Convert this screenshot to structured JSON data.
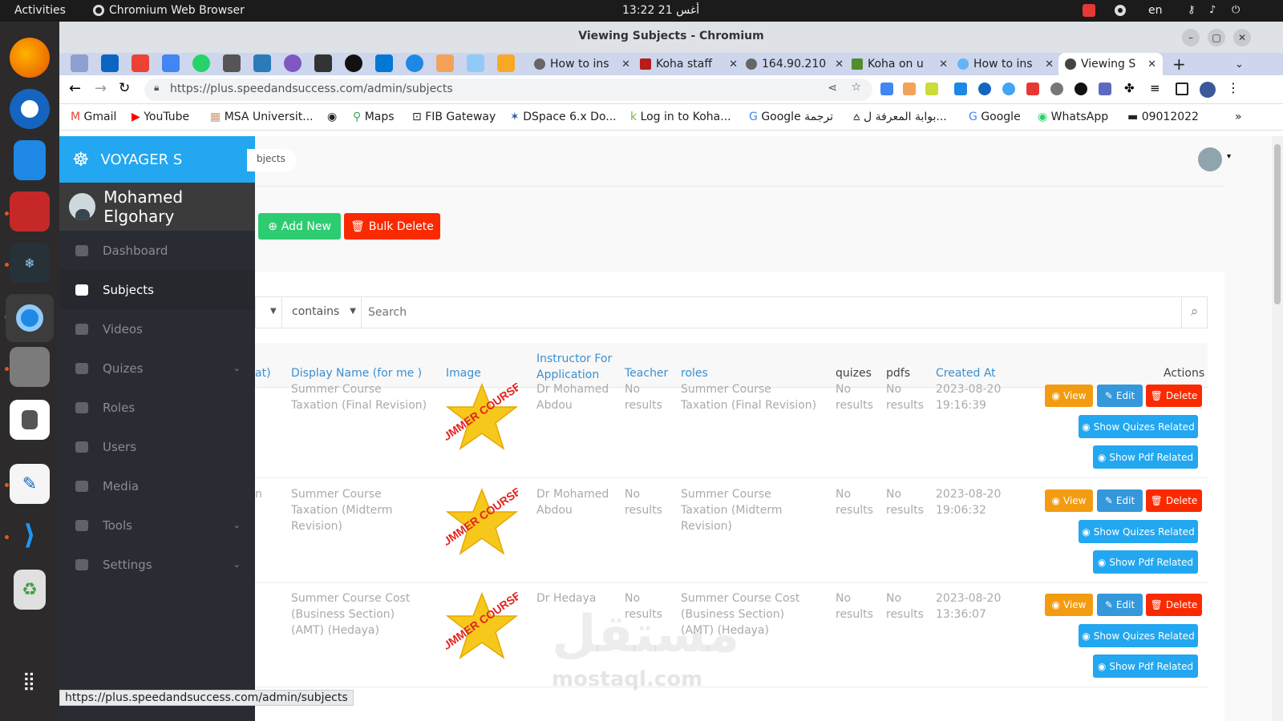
{
  "topbar": {
    "activities": "Activities",
    "app": "Chromium Web Browser",
    "clock": "13:22  21 أغس",
    "lang": "en"
  },
  "window": {
    "title": "Viewing Subjects - Chromium"
  },
  "tabs": [
    {
      "label": "How to ins"
    },
    {
      "label": "Koha staff"
    },
    {
      "label": "164.90.210"
    },
    {
      "label": "Koha on u"
    },
    {
      "label": "How to ins"
    },
    {
      "label": "Viewing S"
    }
  ],
  "address": {
    "url": "https://plus.speedandsuccess.com/admin/subjects"
  },
  "bookmarks": [
    "Gmail",
    "YouTube",
    "MSA Universit...",
    "Maps",
    "FIB Gateway",
    "DSpace 6.x Do...",
    "Log in to Koha...",
    "Google ترجمة",
    "بوابة المعرفة ل...",
    "Google",
    "WhatsApp",
    "09012022"
  ],
  "sidebar": {
    "brand": "VOYAGER S",
    "user": "Mohamed Elgohary",
    "items": [
      {
        "label": "Dashboard"
      },
      {
        "label": "Subjects"
      },
      {
        "label": "Videos"
      },
      {
        "label": "Quizes"
      },
      {
        "label": "Roles"
      },
      {
        "label": "Users"
      },
      {
        "label": "Media"
      },
      {
        "label": "Tools"
      },
      {
        "label": "Settings"
      }
    ]
  },
  "main": {
    "breadcrumb": "bjects",
    "add_new": "Add New",
    "bulk_delete": "Bulk Delete",
    "filter_op": "contains",
    "search_placeholder": "Search",
    "columns": {
      "name": "at)",
      "display": "Display Name (for me )",
      "image": "Image",
      "instructor": "Instructor For Application",
      "teacher": "Teacher",
      "roles": "roles",
      "quizes": "quizes",
      "pdfs": "pdfs",
      "created": "Created At",
      "actions": "Actions"
    },
    "btn_view": "View",
    "btn_edit": "Edit",
    "btn_delete": "Delete",
    "btn_quizes": "Show Quizes Related",
    "btn_pdf": "Show Pdf Related",
    "rows": [
      {
        "name": "",
        "display": "Summer Course Taxation (Final Revision)",
        "image": "SUMMER COURSE",
        "instructor": "Dr Mohamed Abdou",
        "teacher": "No results",
        "roles": "Summer Course Taxation (Final Revision)",
        "quizes": "No results",
        "pdfs": "No results",
        "created": "2023-08-20 19:16:39"
      },
      {
        "name": "n",
        "display": "Summer Course Taxation (Midterm Revision)",
        "image": "SUMMER COURSE",
        "instructor": "Dr Mohamed Abdou",
        "teacher": "No results",
        "roles": "Summer Course Taxation (Midterm Revision)",
        "quizes": "No results",
        "pdfs": "No results",
        "created": "2023-08-20 19:06:32"
      },
      {
        "name": "",
        "display": "Summer Course Cost (Business Section) (AMT) (Hedaya)",
        "image": "SUMMER COURSE",
        "instructor": "Dr Hedaya",
        "teacher": "No results",
        "roles": "Summer Course Cost (Business Section) (AMT) (Hedaya)",
        "quizes": "No results",
        "pdfs": "No results",
        "created": "2023-08-20 13:36:07"
      }
    ]
  },
  "watermark": {
    "ar": "مستقل",
    "en": "mostaql.com"
  },
  "status_url": "https://plus.speedandsuccess.com/admin/subjects"
}
